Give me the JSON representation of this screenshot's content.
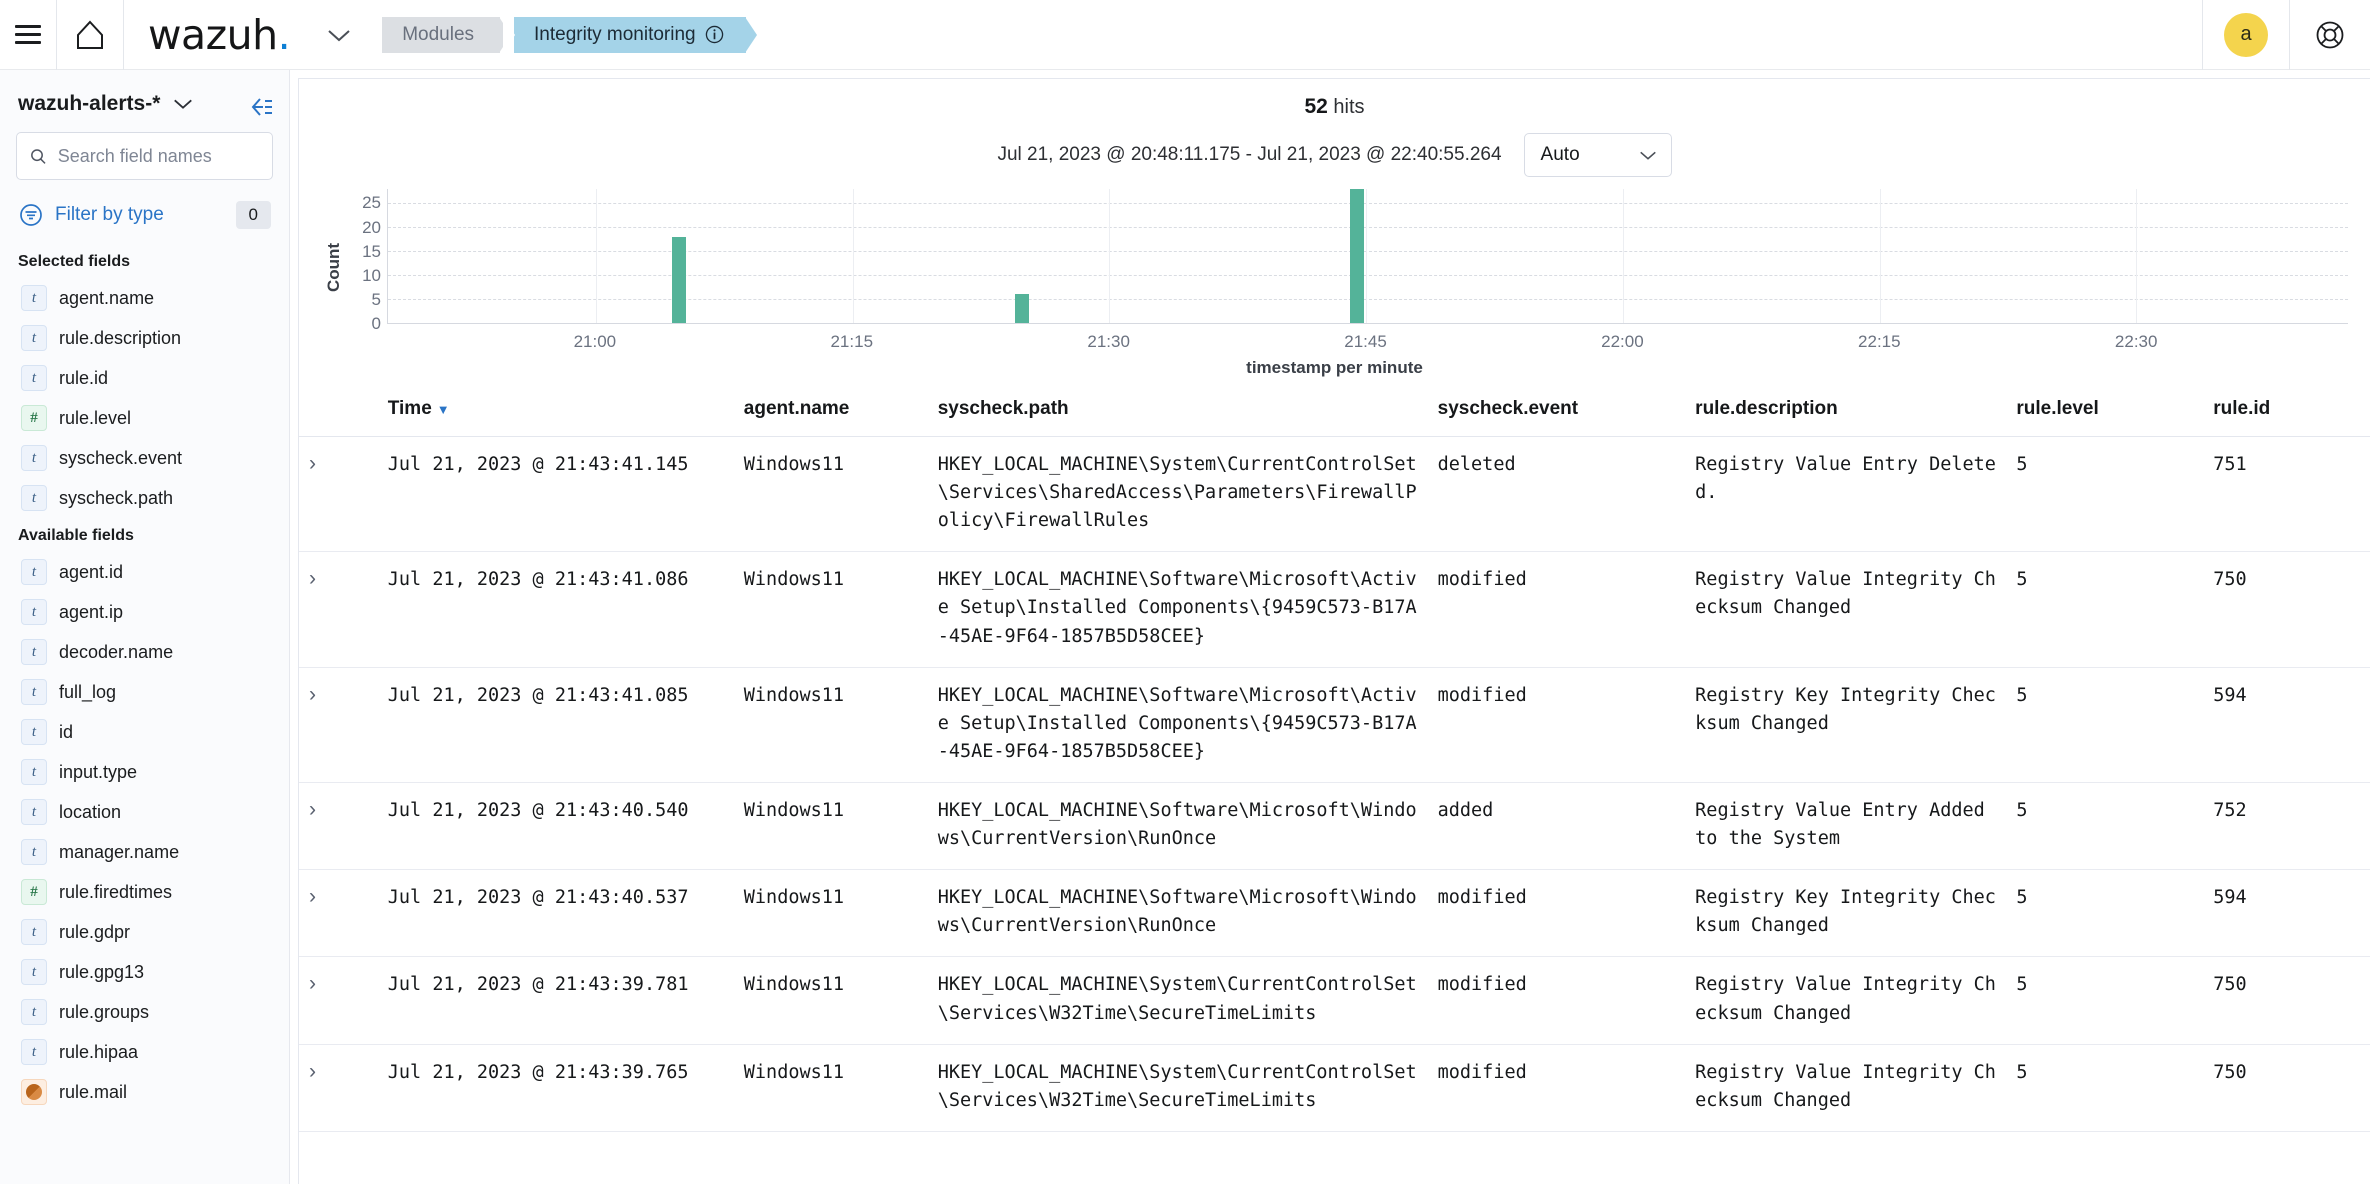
{
  "topnav": {
    "menu_icon": "hamburger-menu-icon",
    "home_icon": "home-icon",
    "brand": "wazuh",
    "brand_dot": ".",
    "brand_chevron": "chevron-down-icon",
    "breadcrumb_modules": "Modules",
    "breadcrumb_active": "Integrity monitoring",
    "breadcrumb_info_icon": "info-circle-icon",
    "avatar_initial": "a",
    "avatar_color": "#f4d44d",
    "help_icon": "help-lifebuoy-icon"
  },
  "sidebar": {
    "index_pattern": "wazuh-alerts-*",
    "index_chevron": "chevron-down-icon",
    "search": {
      "placeholder": "Search field names",
      "value": "",
      "icon": "search-icon"
    },
    "filter_by_type": {
      "label": "Filter by type",
      "count": "0",
      "icon": "filter-funnel-icon"
    },
    "collapse_icon": "collapse-sidebar-icon",
    "selected_fields_title": "Selected fields",
    "selected_fields": [
      {
        "label": "agent.name",
        "type": "t"
      },
      {
        "label": "rule.description",
        "type": "t"
      },
      {
        "label": "rule.id",
        "type": "t"
      },
      {
        "label": "rule.level",
        "type": "#"
      },
      {
        "label": "syscheck.event",
        "type": "t"
      },
      {
        "label": "syscheck.path",
        "type": "t"
      }
    ],
    "available_fields_title": "Available fields",
    "available_fields": [
      {
        "label": "agent.id",
        "type": "t"
      },
      {
        "label": "agent.ip",
        "type": "t"
      },
      {
        "label": "decoder.name",
        "type": "t"
      },
      {
        "label": "full_log",
        "type": "t"
      },
      {
        "label": "id",
        "type": "t"
      },
      {
        "label": "input.type",
        "type": "t"
      },
      {
        "label": "location",
        "type": "t"
      },
      {
        "label": "manager.name",
        "type": "t"
      },
      {
        "label": "rule.firedtimes",
        "type": "#"
      },
      {
        "label": "rule.gdpr",
        "type": "t"
      },
      {
        "label": "rule.gpg13",
        "type": "t"
      },
      {
        "label": "rule.groups",
        "type": "t"
      },
      {
        "label": "rule.hipaa",
        "type": "t"
      },
      {
        "label": "rule.mail",
        "type": "bool"
      }
    ]
  },
  "results": {
    "hits_count": "52",
    "hits_label": "hits",
    "time_range": "Jul 21, 2023 @ 20:48:11.175 - Jul 21, 2023 @ 22:40:55.264",
    "interval_value": "Auto",
    "interval_chevron": "chevron-down-icon"
  },
  "chart_data": {
    "type": "bar",
    "title": "",
    "xlabel": "timestamp per minute",
    "ylabel": "Count",
    "ylim": [
      0,
      28
    ],
    "yticks": [
      0,
      5,
      10,
      15,
      20,
      25
    ],
    "xticks": [
      "21:00",
      "21:15",
      "21:30",
      "21:45",
      "22:00",
      "22:15",
      "22:30"
    ],
    "x_range": [
      "20:48",
      "22:40"
    ],
    "grid": true,
    "legend": "none",
    "bar_color": "#54b399",
    "categories": [
      "21:05",
      "21:22",
      "21:43"
    ],
    "values": [
      18,
      6,
      28
    ],
    "series": [
      {
        "name": "Count",
        "values": [
          18,
          6,
          28
        ]
      }
    ]
  },
  "table": {
    "columns": [
      "Time",
      "agent.name",
      "syscheck.path",
      "syscheck.event",
      "rule.description",
      "rule.level",
      "rule.id"
    ],
    "sort_column": "Time",
    "sort_direction": "desc",
    "rows": [
      {
        "time": "Jul 21, 2023 @ 21:43:41.145",
        "agent_name": "Windows11",
        "syscheck_path": "HKEY_LOCAL_MACHINE\\System\\CurrentControlSet\\Services\\SharedAccess\\Parameters\\FirewallPolicy\\FirewallRules",
        "syscheck_event": "deleted",
        "rule_description": "Registry Value Entry Deleted.",
        "rule_level": "5",
        "rule_id": "751"
      },
      {
        "time": "Jul 21, 2023 @ 21:43:41.086",
        "agent_name": "Windows11",
        "syscheck_path": "HKEY_LOCAL_MACHINE\\Software\\Microsoft\\Active Setup\\Installed Components\\{9459C573-B17A-45AE-9F64-1857B5D58CEE}",
        "syscheck_event": "modified",
        "rule_description": "Registry Value Integrity Checksum Changed",
        "rule_level": "5",
        "rule_id": "750"
      },
      {
        "time": "Jul 21, 2023 @ 21:43:41.085",
        "agent_name": "Windows11",
        "syscheck_path": "HKEY_LOCAL_MACHINE\\Software\\Microsoft\\Active Setup\\Installed Components\\{9459C573-B17A-45AE-9F64-1857B5D58CEE}",
        "syscheck_event": "modified",
        "rule_description": "Registry Key Integrity Checksum Changed",
        "rule_level": "5",
        "rule_id": "594"
      },
      {
        "time": "Jul 21, 2023 @ 21:43:40.540",
        "agent_name": "Windows11",
        "syscheck_path": "HKEY_LOCAL_MACHINE\\Software\\Microsoft\\Windows\\CurrentVersion\\RunOnce",
        "syscheck_event": "added",
        "rule_description": "Registry Value Entry Added to the System",
        "rule_level": "5",
        "rule_id": "752"
      },
      {
        "time": "Jul 21, 2023 @ 21:43:40.537",
        "agent_name": "Windows11",
        "syscheck_path": "HKEY_LOCAL_MACHINE\\Software\\Microsoft\\Windows\\CurrentVersion\\RunOnce",
        "syscheck_event": "modified",
        "rule_description": "Registry Key Integrity Checksum Changed",
        "rule_level": "5",
        "rule_id": "594"
      },
      {
        "time": "Jul 21, 2023 @ 21:43:39.781",
        "agent_name": "Windows11",
        "syscheck_path": "HKEY_LOCAL_MACHINE\\System\\CurrentControlSet\\Services\\W32Time\\SecureTimeLimits",
        "syscheck_event": "modified",
        "rule_description": "Registry Value Integrity Checksum Changed",
        "rule_level": "5",
        "rule_id": "750"
      },
      {
        "time": "Jul 21, 2023 @ 21:43:39.765",
        "agent_name": "Windows11",
        "syscheck_path": "HKEY_LOCAL_MACHINE\\System\\CurrentControlSet\\Services\\W32Time\\SecureTimeLimits",
        "syscheck_event": "modified",
        "rule_description": "Registry Value Integrity Checksum Changed",
        "rule_level": "5",
        "rule_id": "750"
      }
    ]
  },
  "colors": {
    "accent_blue": "#2a74c6",
    "bar_green": "#54b399",
    "tab_active": "#a4d3e8",
    "avatar_yellow": "#f4d44d"
  }
}
